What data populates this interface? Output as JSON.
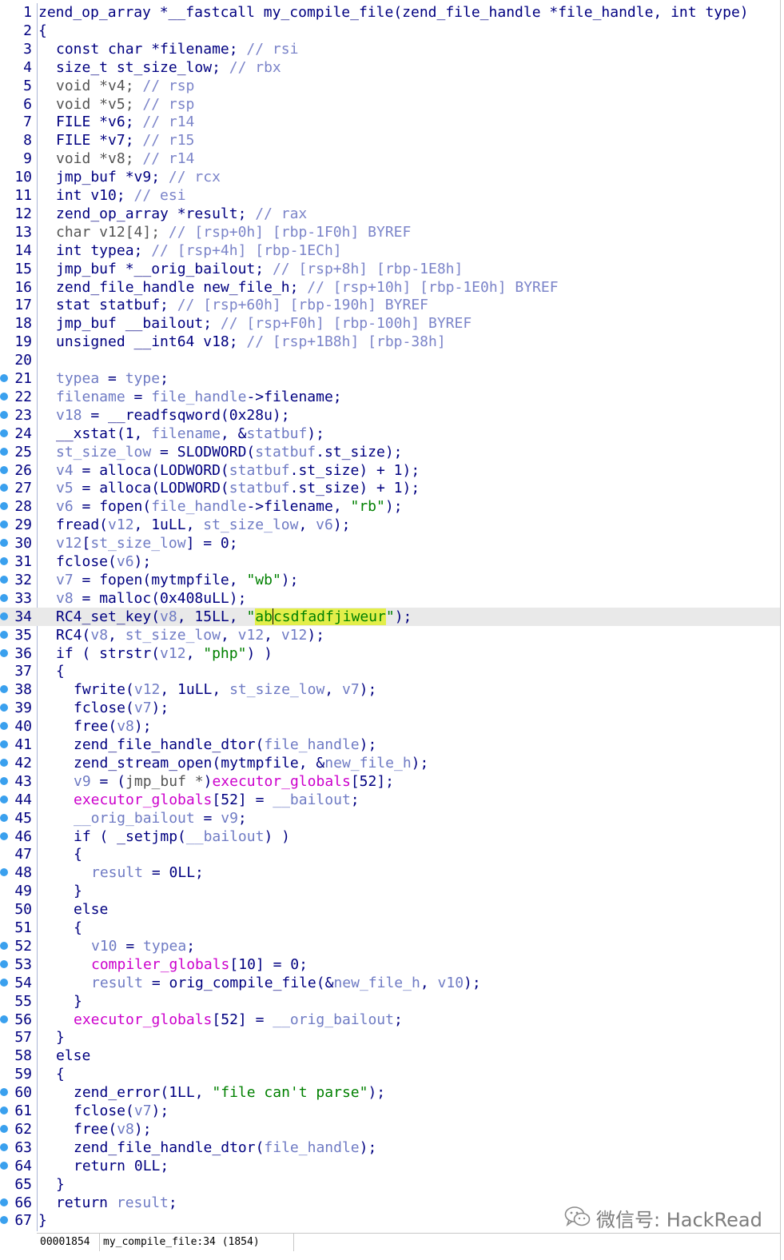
{
  "editor": {
    "current_line": 34,
    "caret_line": 34,
    "lines": [
      {
        "n": "1",
        "bp": false,
        "indent": 0,
        "t": [
          [
            "k",
            "zend_op_array *__fastcall my_compile_file(zend_file_handle *file_handle, int type)"
          ]
        ]
      },
      {
        "n": "2",
        "bp": false,
        "indent": 0,
        "t": [
          [
            "k",
            "{"
          ]
        ]
      },
      {
        "n": "3",
        "bp": false,
        "indent": 1,
        "t": [
          [
            "k",
            "const char *filename; "
          ],
          [
            "c",
            "// rsi"
          ]
        ]
      },
      {
        "n": "4",
        "bp": false,
        "indent": 1,
        "t": [
          [
            "k",
            "size_t st_size_low; "
          ],
          [
            "c",
            "// rbx"
          ]
        ]
      },
      {
        "n": "5",
        "bp": false,
        "indent": 1,
        "t": [
          [
            "t",
            "void *v4; "
          ],
          [
            "c",
            "// rsp"
          ]
        ]
      },
      {
        "n": "6",
        "bp": false,
        "indent": 1,
        "t": [
          [
            "t",
            "void *v5; "
          ],
          [
            "c",
            "// rsp"
          ]
        ]
      },
      {
        "n": "7",
        "bp": false,
        "indent": 1,
        "t": [
          [
            "k",
            "FILE *v6; "
          ],
          [
            "c",
            "// r14"
          ]
        ]
      },
      {
        "n": "8",
        "bp": false,
        "indent": 1,
        "t": [
          [
            "k",
            "FILE *v7; "
          ],
          [
            "c",
            "// r15"
          ]
        ]
      },
      {
        "n": "9",
        "bp": false,
        "indent": 1,
        "t": [
          [
            "t",
            "void *v8; "
          ],
          [
            "c",
            "// r14"
          ]
        ]
      },
      {
        "n": "10",
        "bp": false,
        "indent": 1,
        "t": [
          [
            "k",
            "jmp_buf *v9; "
          ],
          [
            "c",
            "// rcx"
          ]
        ]
      },
      {
        "n": "11",
        "bp": false,
        "indent": 1,
        "t": [
          [
            "k",
            "int v10; "
          ],
          [
            "c",
            "// esi"
          ]
        ]
      },
      {
        "n": "12",
        "bp": false,
        "indent": 1,
        "t": [
          [
            "k",
            "zend_op_array *result; "
          ],
          [
            "c",
            "// rax"
          ]
        ]
      },
      {
        "n": "13",
        "bp": false,
        "indent": 1,
        "t": [
          [
            "t",
            "char v12[4]; "
          ],
          [
            "c",
            "// [rsp+0h] [rbp-1F0h] BYREF"
          ]
        ]
      },
      {
        "n": "14",
        "bp": false,
        "indent": 1,
        "t": [
          [
            "k",
            "int typea; "
          ],
          [
            "c",
            "// [rsp+4h] [rbp-1ECh]"
          ]
        ]
      },
      {
        "n": "15",
        "bp": false,
        "indent": 1,
        "t": [
          [
            "k",
            "jmp_buf *__orig_bailout; "
          ],
          [
            "c",
            "// [rsp+8h] [rbp-1E8h]"
          ]
        ]
      },
      {
        "n": "16",
        "bp": false,
        "indent": 1,
        "t": [
          [
            "k",
            "zend_file_handle new_file_h; "
          ],
          [
            "c",
            "// [rsp+10h] [rbp-1E0h] BYREF"
          ]
        ]
      },
      {
        "n": "17",
        "bp": false,
        "indent": 1,
        "t": [
          [
            "k",
            "stat statbuf; "
          ],
          [
            "c",
            "// [rsp+60h] [rbp-190h] BYREF"
          ]
        ]
      },
      {
        "n": "18",
        "bp": false,
        "indent": 1,
        "t": [
          [
            "k",
            "jmp_buf __bailout; "
          ],
          [
            "c",
            "// [rsp+F0h] [rbp-100h] BYREF"
          ]
        ]
      },
      {
        "n": "19",
        "bp": false,
        "indent": 1,
        "t": [
          [
            "k",
            "unsigned __int64 v18; "
          ],
          [
            "c",
            "// [rsp+1B8h] [rbp-38h]"
          ]
        ]
      },
      {
        "n": "20",
        "bp": false,
        "indent": 0,
        "t": []
      },
      {
        "n": "21",
        "bp": true,
        "indent": 1,
        "t": [
          [
            "v",
            "typea"
          ],
          [
            "k",
            " = "
          ],
          [
            "v",
            "type"
          ],
          [
            "k",
            ";"
          ]
        ]
      },
      {
        "n": "22",
        "bp": true,
        "indent": 1,
        "t": [
          [
            "v",
            "filename"
          ],
          [
            "k",
            " = "
          ],
          [
            "v",
            "file_handle"
          ],
          [
            "k",
            "->filename;"
          ]
        ]
      },
      {
        "n": "23",
        "bp": true,
        "indent": 1,
        "t": [
          [
            "v",
            "v18"
          ],
          [
            "k",
            " = __readfsqword(0x28u);"
          ]
        ]
      },
      {
        "n": "24",
        "bp": true,
        "indent": 1,
        "t": [
          [
            "k",
            "__xstat(1, "
          ],
          [
            "v",
            "filename"
          ],
          [
            "k",
            ", &"
          ],
          [
            "v",
            "statbuf"
          ],
          [
            "k",
            ");"
          ]
        ]
      },
      {
        "n": "25",
        "bp": true,
        "indent": 1,
        "t": [
          [
            "v",
            "st_size_low"
          ],
          [
            "k",
            " = SLODWORD("
          ],
          [
            "v",
            "statbuf"
          ],
          [
            "k",
            ".st_size);"
          ]
        ]
      },
      {
        "n": "26",
        "bp": true,
        "indent": 1,
        "t": [
          [
            "v",
            "v4"
          ],
          [
            "k",
            " = alloca(LODWORD("
          ],
          [
            "v",
            "statbuf"
          ],
          [
            "k",
            ".st_size) + 1);"
          ]
        ]
      },
      {
        "n": "27",
        "bp": true,
        "indent": 1,
        "t": [
          [
            "v",
            "v5"
          ],
          [
            "k",
            " = alloca(LODWORD("
          ],
          [
            "v",
            "statbuf"
          ],
          [
            "k",
            ".st_size) + 1);"
          ]
        ]
      },
      {
        "n": "28",
        "bp": true,
        "indent": 1,
        "t": [
          [
            "v",
            "v6"
          ],
          [
            "k",
            " = fopen("
          ],
          [
            "v",
            "file_handle"
          ],
          [
            "k",
            "->filename, "
          ],
          [
            "s",
            "\"rb\""
          ],
          [
            "k",
            ");"
          ]
        ]
      },
      {
        "n": "29",
        "bp": true,
        "indent": 1,
        "t": [
          [
            "k",
            "fread("
          ],
          [
            "v",
            "v12"
          ],
          [
            "k",
            ", 1uLL, "
          ],
          [
            "v",
            "st_size_low"
          ],
          [
            "k",
            ", "
          ],
          [
            "v",
            "v6"
          ],
          [
            "k",
            ");"
          ]
        ]
      },
      {
        "n": "30",
        "bp": true,
        "indent": 1,
        "t": [
          [
            "v",
            "v12"
          ],
          [
            "k",
            "["
          ],
          [
            "v",
            "st_size_low"
          ],
          [
            "k",
            "] = 0;"
          ]
        ]
      },
      {
        "n": "31",
        "bp": true,
        "indent": 1,
        "t": [
          [
            "k",
            "fclose("
          ],
          [
            "v",
            "v6"
          ],
          [
            "k",
            ");"
          ]
        ]
      },
      {
        "n": "32",
        "bp": true,
        "indent": 1,
        "t": [
          [
            "v",
            "v7"
          ],
          [
            "k",
            " = fopen(mytmpfile, "
          ],
          [
            "s",
            "\"wb\""
          ],
          [
            "k",
            ");"
          ]
        ]
      },
      {
        "n": "33",
        "bp": true,
        "indent": 1,
        "t": [
          [
            "v",
            "v8"
          ],
          [
            "k",
            " = malloc(0x408uLL);"
          ]
        ]
      },
      {
        "n": "34",
        "bp": true,
        "indent": 1,
        "t": [
          [
            "k",
            "RC4_set_key("
          ],
          [
            "v",
            "v8"
          ],
          [
            "k",
            ", 15LL, "
          ],
          [
            "s",
            "\""
          ],
          [
            "h",
            "ab"
          ],
          [
            "caret",
            ""
          ],
          [
            "h",
            "csdfadfjiweur"
          ],
          [
            "s",
            "\""
          ],
          [
            "k",
            ");"
          ]
        ]
      },
      {
        "n": "35",
        "bp": true,
        "indent": 1,
        "t": [
          [
            "k",
            "RC4("
          ],
          [
            "v",
            "v8"
          ],
          [
            "k",
            ", "
          ],
          [
            "v",
            "st_size_low"
          ],
          [
            "k",
            ", "
          ],
          [
            "v",
            "v12"
          ],
          [
            "k",
            ", "
          ],
          [
            "v",
            "v12"
          ],
          [
            "k",
            ");"
          ]
        ]
      },
      {
        "n": "36",
        "bp": true,
        "indent": 1,
        "t": [
          [
            "k",
            "if ( strstr("
          ],
          [
            "v",
            "v12"
          ],
          [
            "k",
            ", "
          ],
          [
            "s",
            "\"php\""
          ],
          [
            "k",
            ") )"
          ]
        ]
      },
      {
        "n": "37",
        "bp": false,
        "indent": 1,
        "t": [
          [
            "k",
            "{"
          ]
        ]
      },
      {
        "n": "38",
        "bp": true,
        "indent": 2,
        "t": [
          [
            "k",
            "fwrite("
          ],
          [
            "v",
            "v12"
          ],
          [
            "k",
            ", 1uLL, "
          ],
          [
            "v",
            "st_size_low"
          ],
          [
            "k",
            ", "
          ],
          [
            "v",
            "v7"
          ],
          [
            "k",
            ");"
          ]
        ]
      },
      {
        "n": "39",
        "bp": true,
        "indent": 2,
        "t": [
          [
            "k",
            "fclose("
          ],
          [
            "v",
            "v7"
          ],
          [
            "k",
            ");"
          ]
        ]
      },
      {
        "n": "40",
        "bp": true,
        "indent": 2,
        "t": [
          [
            "k",
            "free("
          ],
          [
            "v",
            "v8"
          ],
          [
            "k",
            ");"
          ]
        ]
      },
      {
        "n": "41",
        "bp": true,
        "indent": 2,
        "t": [
          [
            "k",
            "zend_file_handle_dtor("
          ],
          [
            "v",
            "file_handle"
          ],
          [
            "k",
            ");"
          ]
        ]
      },
      {
        "n": "42",
        "bp": true,
        "indent": 2,
        "t": [
          [
            "k",
            "zend_stream_open(mytmpfile, &"
          ],
          [
            "v",
            "new_file_h"
          ],
          [
            "k",
            ");"
          ]
        ]
      },
      {
        "n": "43",
        "bp": true,
        "indent": 2,
        "t": [
          [
            "v",
            "v9"
          ],
          [
            "k",
            " = ("
          ],
          [
            "t",
            "jmp_buf *"
          ],
          [
            "k",
            ")"
          ],
          [
            "g",
            "executor_globals"
          ],
          [
            "k",
            "[52];"
          ]
        ]
      },
      {
        "n": "44",
        "bp": true,
        "indent": 2,
        "t": [
          [
            "g",
            "executor_globals"
          ],
          [
            "k",
            "[52] = "
          ],
          [
            "v",
            "__bailout"
          ],
          [
            "k",
            ";"
          ]
        ]
      },
      {
        "n": "45",
        "bp": true,
        "indent": 2,
        "t": [
          [
            "v",
            "__orig_bailout"
          ],
          [
            "k",
            " = "
          ],
          [
            "v",
            "v9"
          ],
          [
            "k",
            ";"
          ]
        ]
      },
      {
        "n": "46",
        "bp": true,
        "indent": 2,
        "t": [
          [
            "k",
            "if ( _setjmp("
          ],
          [
            "v",
            "__bailout"
          ],
          [
            "k",
            ") )"
          ]
        ]
      },
      {
        "n": "47",
        "bp": false,
        "indent": 2,
        "t": [
          [
            "k",
            "{"
          ]
        ]
      },
      {
        "n": "48",
        "bp": true,
        "indent": 3,
        "t": [
          [
            "v",
            "result"
          ],
          [
            "k",
            " = 0LL;"
          ]
        ]
      },
      {
        "n": "49",
        "bp": false,
        "indent": 2,
        "t": [
          [
            "k",
            "}"
          ]
        ]
      },
      {
        "n": "50",
        "bp": false,
        "indent": 2,
        "t": [
          [
            "k",
            "else"
          ]
        ]
      },
      {
        "n": "51",
        "bp": false,
        "indent": 2,
        "t": [
          [
            "k",
            "{"
          ]
        ]
      },
      {
        "n": "52",
        "bp": true,
        "indent": 3,
        "t": [
          [
            "v",
            "v10"
          ],
          [
            "k",
            " = "
          ],
          [
            "v",
            "typea"
          ],
          [
            "k",
            ";"
          ]
        ]
      },
      {
        "n": "53",
        "bp": true,
        "indent": 3,
        "t": [
          [
            "g",
            "compiler_globals"
          ],
          [
            "k",
            "[10] = 0;"
          ]
        ]
      },
      {
        "n": "54",
        "bp": true,
        "indent": 3,
        "t": [
          [
            "v",
            "result"
          ],
          [
            "k",
            " = orig_compile_file(&"
          ],
          [
            "v",
            "new_file_h"
          ],
          [
            "k",
            ", "
          ],
          [
            "v",
            "v10"
          ],
          [
            "k",
            ");"
          ]
        ]
      },
      {
        "n": "55",
        "bp": false,
        "indent": 2,
        "t": [
          [
            "k",
            "}"
          ]
        ]
      },
      {
        "n": "56",
        "bp": true,
        "indent": 2,
        "t": [
          [
            "g",
            "executor_globals"
          ],
          [
            "k",
            "[52] = "
          ],
          [
            "v",
            "__orig_bailout"
          ],
          [
            "k",
            ";"
          ]
        ]
      },
      {
        "n": "57",
        "bp": false,
        "indent": 1,
        "t": [
          [
            "k",
            "}"
          ]
        ]
      },
      {
        "n": "58",
        "bp": false,
        "indent": 1,
        "t": [
          [
            "k",
            "else"
          ]
        ]
      },
      {
        "n": "59",
        "bp": false,
        "indent": 1,
        "t": [
          [
            "k",
            "{"
          ]
        ]
      },
      {
        "n": "60",
        "bp": true,
        "indent": 2,
        "t": [
          [
            "k",
            "zend_error(1LL, "
          ],
          [
            "s",
            "\"file can't parse\""
          ],
          [
            "k",
            ");"
          ]
        ]
      },
      {
        "n": "61",
        "bp": true,
        "indent": 2,
        "t": [
          [
            "k",
            "fclose("
          ],
          [
            "v",
            "v7"
          ],
          [
            "k",
            ");"
          ]
        ]
      },
      {
        "n": "62",
        "bp": true,
        "indent": 2,
        "t": [
          [
            "k",
            "free("
          ],
          [
            "v",
            "v8"
          ],
          [
            "k",
            ");"
          ]
        ]
      },
      {
        "n": "63",
        "bp": true,
        "indent": 2,
        "t": [
          [
            "k",
            "zend_file_handle_dtor("
          ],
          [
            "v",
            "file_handle"
          ],
          [
            "k",
            ");"
          ]
        ]
      },
      {
        "n": "64",
        "bp": true,
        "indent": 2,
        "t": [
          [
            "k",
            "return 0LL;"
          ]
        ]
      },
      {
        "n": "65",
        "bp": false,
        "indent": 1,
        "t": [
          [
            "k",
            "}"
          ]
        ]
      },
      {
        "n": "66",
        "bp": true,
        "indent": 1,
        "t": [
          [
            "k",
            "return "
          ],
          [
            "v",
            "result"
          ],
          [
            "k",
            ";"
          ]
        ]
      },
      {
        "n": "67",
        "bp": true,
        "indent": 0,
        "t": [
          [
            "k",
            "}"
          ]
        ]
      }
    ]
  },
  "status_bar": {
    "address": "00001854",
    "location": "my_compile_file:34 (1854)"
  },
  "watermark": {
    "text": "微信号: HackRead",
    "icon": "wechat-icon"
  },
  "colors": {
    "keyword_text": "#000080",
    "variable": "#6f7bc4",
    "comment": "#7b84c9",
    "string": "#008000",
    "global": "#cc00cc",
    "highlight": "#e3ee4a",
    "breakpoint_dot": "#3aa0ee",
    "current_line_bg": "#e9e9e9"
  }
}
